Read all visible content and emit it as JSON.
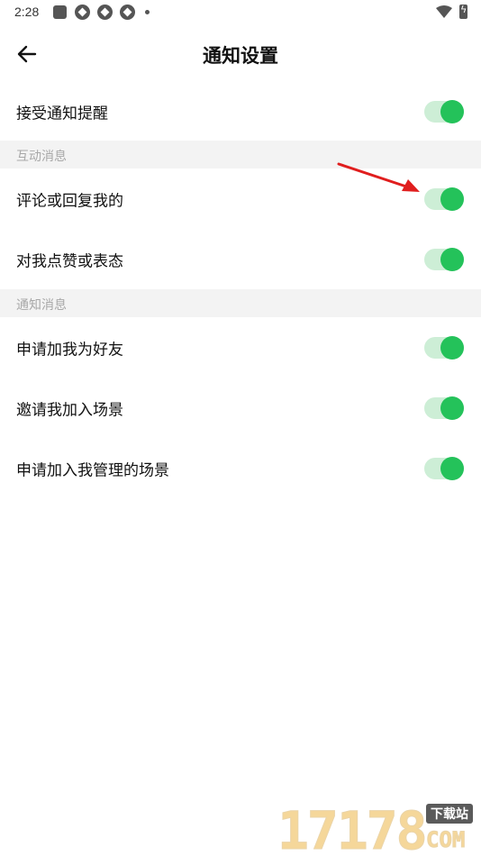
{
  "status_bar": {
    "time": "2:28",
    "icons": [
      "notification-square-icon",
      "app-pin-icon",
      "app-pin-icon",
      "app-pin-icon",
      "more-dot-icon",
      "wifi-icon",
      "battery-charging-icon"
    ]
  },
  "header": {
    "back_icon": "arrow-left-icon",
    "title": "通知设置"
  },
  "settings": {
    "master": {
      "label": "接受通知提醒",
      "enabled": true
    },
    "sections": [
      {
        "title": "互动消息",
        "items": [
          {
            "label": "评论或回复我的",
            "enabled": true
          },
          {
            "label": "对我点赞或表态",
            "enabled": true
          }
        ]
      },
      {
        "title": "通知消息",
        "items": [
          {
            "label": "申请加我为好友",
            "enabled": true
          },
          {
            "label": "邀请我加入场景",
            "enabled": true
          },
          {
            "label": "申请加入我管理的场景",
            "enabled": true
          }
        ]
      }
    ]
  },
  "colors": {
    "toggle_on_knob": "#24c25a",
    "toggle_on_track": "#cdeed6",
    "section_bg": "#f3f3f3",
    "annotation_arrow": "#e01e1e"
  },
  "watermark": {
    "digits": "17178",
    "tag": "下载站",
    "suffix": "COM"
  }
}
